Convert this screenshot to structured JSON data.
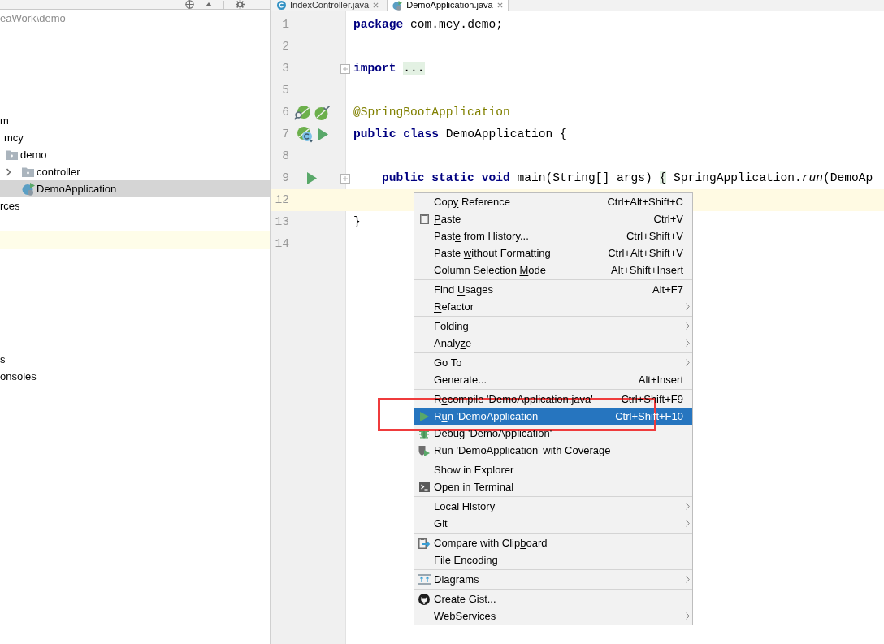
{
  "project_panel": {
    "path": "eaWork\\demo",
    "tree": [
      {
        "label": "m",
        "expanded": true,
        "selected": false,
        "children": [
          {
            "label": "mcy",
            "expanded": true,
            "selected": false,
            "children": [
              {
                "label": "demo",
                "kind": "package",
                "expanded": true,
                "selected": false,
                "children": [
                  {
                    "label": "controller",
                    "kind": "package",
                    "expanded": false,
                    "selected": false
                  },
                  {
                    "label": "DemoApplication",
                    "kind": "spring-class",
                    "selected": true
                  }
                ]
              }
            ]
          }
        ]
      },
      {
        "label": "rces",
        "selected": false
      }
    ],
    "tail": [
      {
        "label": "s",
        "selected": false
      },
      {
        "label": "onsoles",
        "selected": false
      }
    ]
  },
  "editor": {
    "tabs": [
      {
        "label": "IndexController.java",
        "kind": "class",
        "selected": false
      },
      {
        "label": "DemoApplication.java",
        "kind": "spring-class",
        "selected": true
      }
    ],
    "lines": [
      {
        "number": "1",
        "current": false,
        "folded": false,
        "tokens": [
          {
            "text": "package",
            "kind": "keyword"
          },
          {
            "text": " com.mcy.demo;",
            "kind": "plain"
          }
        ]
      },
      {
        "number": "2",
        "current": false,
        "folded": false
      },
      {
        "number": "3",
        "current": false,
        "folded": true,
        "tokens": [
          {
            "text": "import ",
            "kind": "keyword"
          },
          {
            "text": "...",
            "kind": "folded-region"
          }
        ]
      },
      {
        "number": "5",
        "current": false,
        "folded": false
      },
      {
        "number": "6",
        "current": false,
        "folded": false,
        "markers": [
          {
            "kind": "spring-find"
          },
          {
            "kind": "spring-check"
          }
        ],
        "tokens": [
          {
            "text": "@SpringBootApplication",
            "kind": "annotation"
          }
        ]
      },
      {
        "number": "7",
        "current": false,
        "folded": false,
        "markers": [
          {
            "kind": "spring-bean"
          },
          {
            "kind": "run"
          }
        ],
        "tokens": [
          {
            "text": "public class ",
            "kind": "keyword"
          },
          {
            "text": "DemoApplication {",
            "kind": "plain"
          }
        ]
      },
      {
        "number": "8",
        "current": false,
        "folded": false
      },
      {
        "number": "9",
        "current": false,
        "folded": true,
        "markers": [
          {
            "kind": "run"
          }
        ],
        "tokens": [
          {
            "text": "    public static void ",
            "kind": "keyword"
          },
          {
            "text": "main(String[] args) ",
            "kind": "plain"
          },
          {
            "text": "{",
            "kind": "folded-region"
          },
          {
            "text": " SpringApplication.",
            "kind": "plain"
          },
          {
            "text": "run",
            "kind": "static-method"
          },
          {
            "text": "(DemoAp",
            "kind": "plain"
          }
        ]
      },
      {
        "number": "12",
        "current": true,
        "folded": false
      },
      {
        "number": "13",
        "current": false,
        "folded": false,
        "tokens": [
          {
            "text": "}",
            "kind": "plain"
          }
        ]
      },
      {
        "number": "14",
        "current": false,
        "folded": false
      }
    ]
  },
  "context_menu": {
    "groups": [
      {
        "items": [
          {
            "before": "Cop",
            "mnemonic": "y",
            "after": " Reference",
            "shortcut": "Ctrl+Alt+Shift+C",
            "kind": "plain",
            "submenu": false,
            "selected": false
          },
          {
            "mnemonic": "P",
            "after": "aste",
            "shortcut": "Ctrl+V",
            "kind": "paste",
            "submenu": false,
            "selected": false
          },
          {
            "before": "Past",
            "mnemonic": "e",
            "after": " from History...",
            "shortcut": "Ctrl+Shift+V",
            "kind": "plain",
            "submenu": false,
            "selected": false
          },
          {
            "before": "Paste ",
            "mnemonic": "w",
            "after": "ithout Formatting",
            "shortcut": "Ctrl+Alt+Shift+V",
            "kind": "plain",
            "submenu": false,
            "selected": false
          },
          {
            "before": "Column Selection ",
            "mnemonic": "M",
            "after": "ode",
            "shortcut": "Alt+Shift+Insert",
            "kind": "plain",
            "submenu": false,
            "selected": false
          }
        ]
      },
      {
        "items": [
          {
            "before": "Find ",
            "mnemonic": "U",
            "after": "sages",
            "shortcut": "Alt+F7",
            "kind": "plain",
            "submenu": false,
            "selected": false
          },
          {
            "mnemonic": "R",
            "after": "efactor",
            "kind": "plain",
            "submenu": true,
            "selected": false
          }
        ]
      },
      {
        "items": [
          {
            "label": "Folding",
            "kind": "plain",
            "submenu": true,
            "selected": false
          },
          {
            "before": "Analy",
            "mnemonic": "z",
            "after": "e",
            "kind": "plain",
            "submenu": true,
            "selected": false
          }
        ]
      },
      {
        "items": [
          {
            "label": "Go To",
            "kind": "plain",
            "submenu": true,
            "selected": false
          },
          {
            "label": "Generate...",
            "shortcut": "Alt+Insert",
            "kind": "plain",
            "submenu": false,
            "selected": false
          }
        ]
      },
      {
        "items": [
          {
            "before": "R",
            "mnemonic": "e",
            "after": "compile 'DemoApplication.java'",
            "shortcut": "Ctrl+Shift+F9",
            "kind": "plain",
            "submenu": false,
            "selected": false
          },
          {
            "before": "R",
            "mnemonic": "u",
            "after": "n 'DemoApplication'",
            "shortcut": "Ctrl+Shift+F10",
            "kind": "run",
            "submenu": false,
            "selected": true
          },
          {
            "mnemonic": "D",
            "after": "ebug 'DemoApplication'",
            "kind": "debug",
            "submenu": false,
            "selected": false
          },
          {
            "before": "Run 'DemoApplication' with Co",
            "mnemonic": "v",
            "after": "erage",
            "kind": "coverage",
            "submenu": false,
            "selected": false
          }
        ]
      },
      {
        "items": [
          {
            "label": "Show in Explorer",
            "kind": "plain",
            "submenu": false,
            "selected": false
          },
          {
            "label": "Open in Terminal",
            "kind": "terminal",
            "submenu": false,
            "selected": false
          }
        ]
      },
      {
        "items": [
          {
            "before": "Local ",
            "mnemonic": "H",
            "after": "istory",
            "kind": "plain",
            "submenu": true,
            "selected": false
          },
          {
            "mnemonic": "G",
            "after": "it",
            "kind": "plain",
            "submenu": true,
            "selected": false
          }
        ]
      },
      {
        "items": [
          {
            "before": "Compare with Clip",
            "mnemonic": "b",
            "after": "oard",
            "kind": "compare",
            "submenu": false,
            "selected": false
          },
          {
            "label": "File Encoding",
            "kind": "plain",
            "submenu": false,
            "selected": false
          }
        ]
      },
      {
        "items": [
          {
            "label": "Diagrams",
            "kind": "diagram",
            "submenu": true,
            "selected": false
          }
        ]
      },
      {
        "items": [
          {
            "label": "Create Gist...",
            "kind": "gist",
            "submenu": false,
            "selected": false
          },
          {
            "label": "WebServices",
            "kind": "plain",
            "submenu": true,
            "selected": false
          }
        ]
      }
    ]
  }
}
